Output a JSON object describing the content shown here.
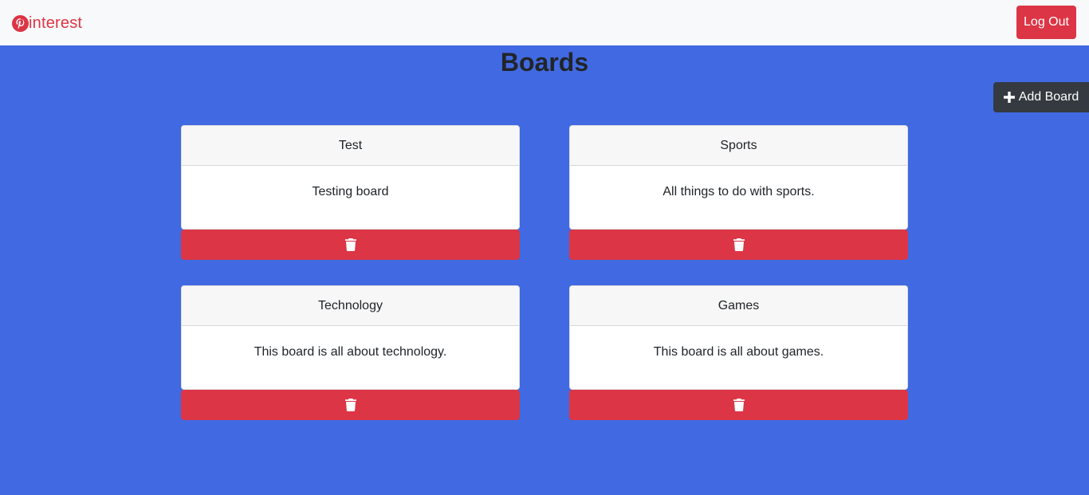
{
  "nav": {
    "brand": "interest",
    "logout_label": "Log Out"
  },
  "page": {
    "title": "Boards",
    "add_label": "Add Board"
  },
  "boards": [
    {
      "name": "Test",
      "description": "Testing board"
    },
    {
      "name": "Sports",
      "description": "All things to do with sports."
    },
    {
      "name": "Technology",
      "description": "This board is all about technology."
    },
    {
      "name": "Games",
      "description": "This board is all about games."
    }
  ],
  "colors": {
    "background": "#4169e1",
    "brand": "#dc3545",
    "danger": "#dc3545",
    "dark": "#343a40",
    "navbar": "#f8f9fa"
  },
  "icons": {
    "brand": "pinterest-icon",
    "add": "plus-icon",
    "delete": "trash-icon"
  }
}
